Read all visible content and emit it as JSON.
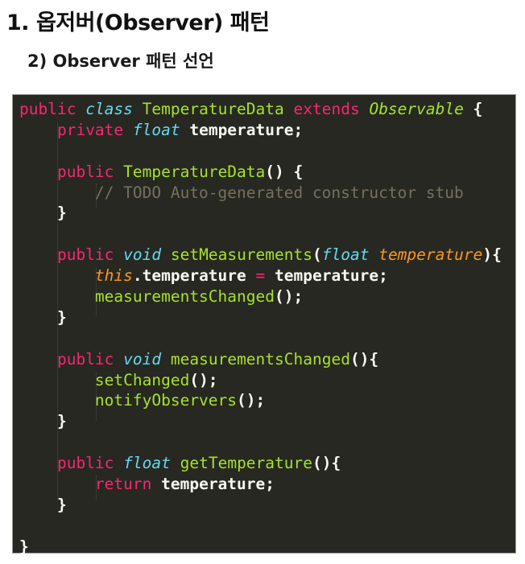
{
  "heading": {
    "title": "1. 옵저버(Observer) 패턴",
    "subtitle": "2) Observer 패턴 선언"
  },
  "code": {
    "language": "java",
    "theme_colors": {
      "background": "#272822",
      "keyword": "#f92672",
      "type": "#66d9ef",
      "function": "#a6e22e",
      "parameter": "#fd971f",
      "comment": "#75715e",
      "plain": "#f8f8f2"
    },
    "lines": [
      [
        {
          "t": "public",
          "c": "kw"
        },
        {
          "t": " ",
          "c": "pl"
        },
        {
          "t": "class",
          "c": "ty"
        },
        {
          "t": " ",
          "c": "pl"
        },
        {
          "t": "TemperatureData",
          "c": "cls"
        },
        {
          "t": " ",
          "c": "pl"
        },
        {
          "t": "extends",
          "c": "kw"
        },
        {
          "t": " ",
          "c": "pl"
        },
        {
          "t": "Observable",
          "c": "ext"
        },
        {
          "t": " {",
          "c": "pl"
        }
      ],
      [
        {
          "t": "    ",
          "c": "pl"
        },
        {
          "t": "private",
          "c": "kw"
        },
        {
          "t": " ",
          "c": "pl"
        },
        {
          "t": "float",
          "c": "ty"
        },
        {
          "t": " temperature;",
          "c": "pl"
        }
      ],
      [],
      [
        {
          "t": "    ",
          "c": "pl"
        },
        {
          "t": "public",
          "c": "kw"
        },
        {
          "t": " ",
          "c": "pl"
        },
        {
          "t": "TemperatureData",
          "c": "fn"
        },
        {
          "t": "() {",
          "c": "pl"
        }
      ],
      [
        {
          "t": "        ",
          "c": "pl"
        },
        {
          "t": "// TODO Auto-generated constructor stub",
          "c": "cm"
        }
      ],
      [
        {
          "t": "    }",
          "c": "pl"
        }
      ],
      [],
      [
        {
          "t": "    ",
          "c": "pl"
        },
        {
          "t": "public",
          "c": "kw"
        },
        {
          "t": " ",
          "c": "pl"
        },
        {
          "t": "void",
          "c": "ty"
        },
        {
          "t": " ",
          "c": "pl"
        },
        {
          "t": "setMeasurements",
          "c": "fn"
        },
        {
          "t": "(",
          "c": "pl"
        },
        {
          "t": "float",
          "c": "ty"
        },
        {
          "t": " ",
          "c": "pl"
        },
        {
          "t": "temperature",
          "c": "param"
        },
        {
          "t": "){",
          "c": "pl"
        }
      ],
      [
        {
          "t": "        ",
          "c": "pl"
        },
        {
          "t": "this",
          "c": "this"
        },
        {
          "t": ".temperature ",
          "c": "pl"
        },
        {
          "t": "=",
          "c": "op"
        },
        {
          "t": " temperature;",
          "c": "pl"
        }
      ],
      [
        {
          "t": "        ",
          "c": "pl"
        },
        {
          "t": "measurementsChanged",
          "c": "fn"
        },
        {
          "t": "();",
          "c": "pl"
        }
      ],
      [
        {
          "t": "    }",
          "c": "pl"
        }
      ],
      [],
      [
        {
          "t": "    ",
          "c": "pl"
        },
        {
          "t": "public",
          "c": "kw"
        },
        {
          "t": " ",
          "c": "pl"
        },
        {
          "t": "void",
          "c": "ty"
        },
        {
          "t": " ",
          "c": "pl"
        },
        {
          "t": "measurementsChanged",
          "c": "fn"
        },
        {
          "t": "(){",
          "c": "pl"
        }
      ],
      [
        {
          "t": "        ",
          "c": "pl"
        },
        {
          "t": "setChanged",
          "c": "fn"
        },
        {
          "t": "();",
          "c": "pl"
        }
      ],
      [
        {
          "t": "        ",
          "c": "pl"
        },
        {
          "t": "notifyObservers",
          "c": "fn"
        },
        {
          "t": "();",
          "c": "pl"
        }
      ],
      [
        {
          "t": "    }",
          "c": "pl"
        }
      ],
      [],
      [
        {
          "t": "    ",
          "c": "pl"
        },
        {
          "t": "public",
          "c": "kw"
        },
        {
          "t": " ",
          "c": "pl"
        },
        {
          "t": "float",
          "c": "ty"
        },
        {
          "t": " ",
          "c": "pl"
        },
        {
          "t": "getTemperature",
          "c": "fn"
        },
        {
          "t": "(){",
          "c": "pl"
        }
      ],
      [
        {
          "t": "        ",
          "c": "pl"
        },
        {
          "t": "return",
          "c": "kw"
        },
        {
          "t": " temperature;",
          "c": "pl"
        }
      ],
      [
        {
          "t": "    }",
          "c": "pl"
        }
      ],
      [],
      [
        {
          "t": "}",
          "c": "pl"
        }
      ]
    ]
  }
}
